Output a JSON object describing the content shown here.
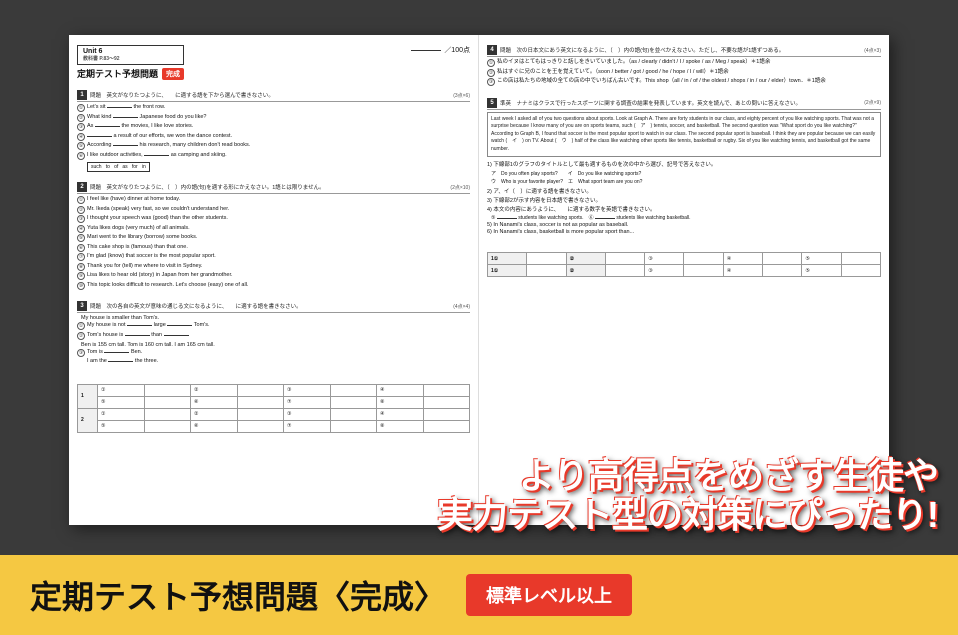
{
  "document": {
    "unit": "Unit 6",
    "unit_range": "教科書 P.83〜92",
    "main_title": "定期テスト予想問題",
    "kansei_label": "完成",
    "score_label": "／100点",
    "sections": [
      {
        "number": "1",
        "instruction": "問題　英文がなりたつように、　　に適する語を下から選んで書きなさい。",
        "points": "(3点×6)",
        "items": [
          "① Let's sit　　　　　the front row.",
          "② What kind　　　　　Japanese food do you like?",
          "③ As　　　　　the movies, I like love stories.",
          "④　　　　　a result of our efforts, we won the dance contest.",
          "⑤ According　　　　　his research, many children don't read books.",
          "⑥ I like outdoor activities,　　　　　as camping and skiing."
        ],
        "options": "such to  of  as  for  in"
      },
      {
        "number": "2",
        "instruction": "問題　英文がなりたつように、（　）内の語(句)を適する形にかえなさい。1語とは限りません。",
        "points": "(2点×10)",
        "items": [
          "① I feel like (have) dinner at home today.",
          "② Mr. Ikeda (speak) very fast, so we couldn't understand her.",
          "③ I thought your speech was (good) than the other students.",
          "④ Yuta likes dogs (very much) of all animals.",
          "⑤ Mari went to the library (borrow) some books.",
          "⑥ This cake shop is (famous) than that one.",
          "⑦ I'm glad (know) that soccer is the most popular sport.",
          "⑧ Thank you for (tell) me where to visit in Sydney.",
          "⑨ Lisa likes to hear old (story) in Japan from her grandmother.",
          "⑩ This topic looks difficult to research. Let's choose (easy) one of all."
        ]
      },
      {
        "number": "3",
        "instruction": "問題　次の各自の英文が意味の通じる文になるように、　　に適する語を書きなさい。",
        "points": "(4点×4)",
        "items": [
          "My house is smaller than Tom's.",
          "① My house is not　　　large　　　Tom's.",
          "② Tom's house is　　　　　than　　　",
          "Ben is 155 cm tall. Tom is 160 cm tall. I am 165 cm tall.",
          "③ Tom is　　　　　Ben.",
          "　I am the　　　　　the three."
        ]
      }
    ],
    "right_sections": [
      {
        "number": "4",
        "instruction": "問題　次の日本文にあう英文になるように、（　）内の語(句)を並べかえなさい。ただし、不要な語が1語ずつある。",
        "points": "(4点×3)",
        "items": [
          "① 私のイヌはとてもはっきりと話しをきいていました。（as / clearly / didn't / I / spoke / as / Meg / speak）＊1語余",
          "② 私はすぐに兄のことを王を覚えていて。（soon / better / got / good / he / hope / I / will）＊1語余",
          "③ この店は私たちの地域の全ての店の中でいちばん古いです。This shop（all / in / of / the oldest / shops / in / our / elder）town．＊1語余"
        ]
      },
      {
        "number": "5",
        "instruction": "準英　ナナミはクラスで行ったスポーツに関する調査の結果を発表しています。英文を読んで、あとの問いに答えなさい。",
        "points": "(2点×9)",
        "passage": "Last week I asked all of you two questions about sports. Look at Graph A. There are forty students in our class, and eighty percent of you like watching sports. That was not a surprise because I know many of you are on sports teams, such (　ア　) tennis, soccer, and basketball. The second question was \"What sport do you like watching?\" According to Graph B, I found that soccer is the most popular sport to watch in our class. The second popular sport is baseball. I think they are popular because we can easily watch (　イ　) on TV. About (　ウ　) half of the class like watching other sports like tennis, basketball or rugby. Six of you like watching tennis, and basketball got the same number.",
        "sub_questions": [
          "1) 下線部1のグラフのタイトルとして最も適するものを次の中から選び、記号で答えなさい。",
          "ア　Do you often play sports?　　イ　Do you like watching sports?",
          "ウ　Who is your favorite player?　エ　What sport team are you on?",
          "2) ア、イ（　）に適する語を書きなさい。",
          "3) 下線部2が示す内容を日本語で書きなさい。",
          "4) 本文の内容にあうように、　　に適する数字を英語で書きなさい。",
          "　⑤　students like watching sports.　⑥　students like watching basketball.",
          "5) In Nanami's class, soccer is not as popular as baseball.",
          "6) In Nanami's class, basketball is more popular sport than..."
        ]
      }
    ]
  },
  "promo": {
    "line1": "より高得点をめざす生徒や",
    "line2": "実力テスト型の対策にぴったり!"
  },
  "banner": {
    "main_text": "定期テスト予想問題〈完成〉",
    "level_badge": "標準レベル以上"
  },
  "answer_grid": {
    "rows": [
      {
        "label": "1",
        "cells": [
          "(1)",
          "(2)",
          "(3)",
          "(4)"
        ]
      },
      {
        "label": "",
        "cells": [
          "(5)",
          "(6)",
          "(7)",
          "(8)"
        ]
      },
      {
        "label": "2",
        "cells": [
          "(1)",
          "(2)",
          "(3)",
          "(4)"
        ]
      },
      {
        "label": "",
        "cells": [
          "(5)",
          "(6)",
          "(7)",
          "(8)"
        ]
      }
    ]
  }
}
